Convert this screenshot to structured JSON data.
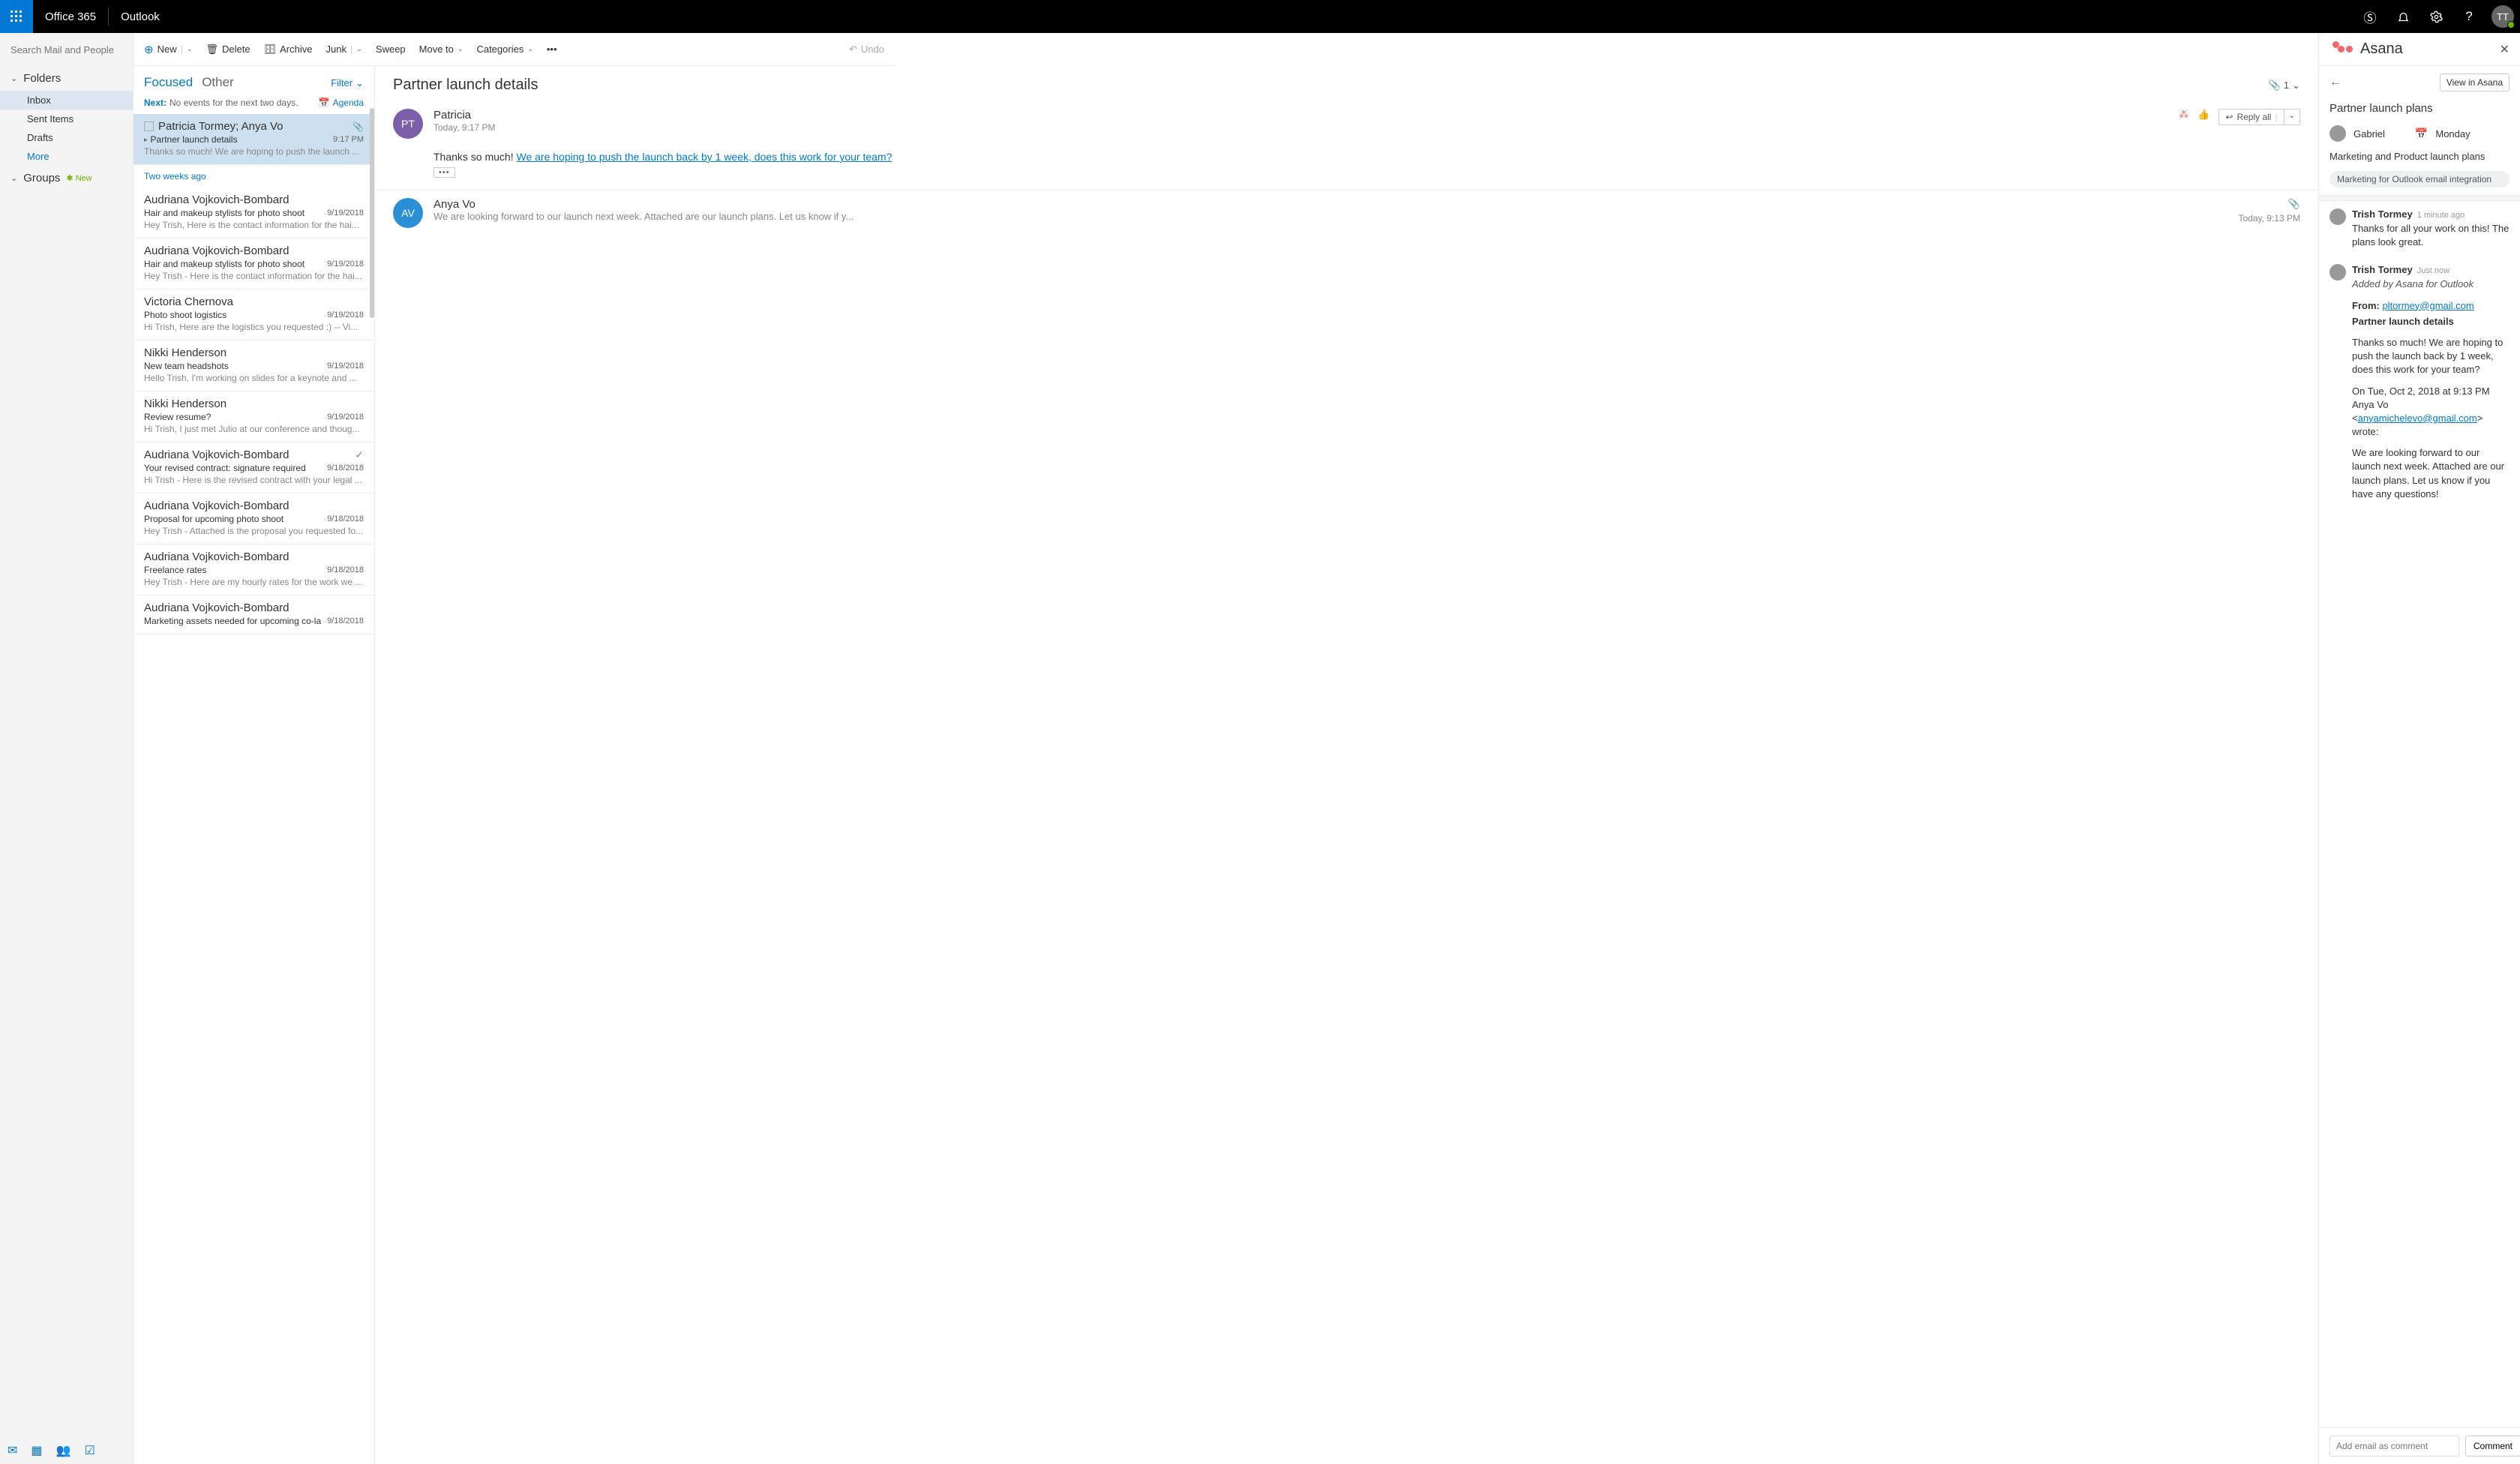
{
  "topbar": {
    "brand": "Office 365",
    "app": "Outlook",
    "avatar_initials": "TT"
  },
  "search": {
    "placeholder": "Search Mail and People"
  },
  "nav": {
    "folders_label": "Folders",
    "inbox": "Inbox",
    "sent": "Sent Items",
    "drafts": "Drafts",
    "more": "More",
    "groups_label": "Groups",
    "new": "New"
  },
  "toolbar": {
    "new": "New",
    "delete": "Delete",
    "archive": "Archive",
    "junk": "Junk",
    "sweep": "Sweep",
    "moveto": "Move to",
    "categories": "Categories",
    "undo": "Undo"
  },
  "list": {
    "focused": "Focused",
    "other": "Other",
    "filter": "Filter",
    "next": "Next:",
    "next_text": "No events for the next two days.",
    "agenda": "Agenda",
    "section_twoweeks": "Two weeks ago",
    "items": [
      {
        "from": "Patricia Tormey; Anya Vo",
        "subj": "Partner launch details",
        "time": "9:17 PM",
        "prev": "Thanks so much! We are hoping to push the launch ...",
        "attach": true,
        "sel": true,
        "thread": true
      },
      {
        "from": "Audriana Vojkovich-Bombard",
        "subj": "Hair and makeup stylists for photo shoot",
        "time": "9/19/2018",
        "prev": "Hey Trish,  Here is the contact information for the hai..."
      },
      {
        "from": "Audriana Vojkovich-Bombard",
        "subj": "Hair and makeup stylists for photo shoot",
        "time": "9/19/2018",
        "prev": "Hey Trish - Here is the contact information for the hai..."
      },
      {
        "from": "Victoria Chernova",
        "subj": "Photo shoot logistics",
        "time": "9/19/2018",
        "prev": "Hi Trish,  Here are the logistics you requested :)  --  Vi..."
      },
      {
        "from": "Nikki Henderson",
        "subj": "New team headshots",
        "time": "9/19/2018",
        "prev": "Hello Trish,  I'm working on slides for a keynote and ..."
      },
      {
        "from": "Nikki Henderson",
        "subj": "Review resume?",
        "time": "9/19/2018",
        "prev": "Hi Trish,  I just met Julio at our conference and thoug..."
      },
      {
        "from": "Audriana Vojkovich-Bombard",
        "subj": "Your revised contract: signature required",
        "time": "9/18/2018",
        "prev": "Hi Trish - Here is the revised contract with your legal ...",
        "done": true
      },
      {
        "from": "Audriana Vojkovich-Bombard",
        "subj": "Proposal for upcoming photo shoot",
        "time": "9/18/2018",
        "prev": "Hey Trish - Attached is the proposal you requested fo..."
      },
      {
        "from": "Audriana Vojkovich-Bombard",
        "subj": "Freelance rates",
        "time": "9/18/2018",
        "prev": "Hey Trish - Here are my hourly rates for the work we ..."
      },
      {
        "from": "Audriana Vojkovich-Bombard",
        "subj": "Marketing assets needed for upcoming co-la",
        "time": "9/18/2018",
        "prev": ""
      }
    ]
  },
  "reading": {
    "subject": "Partner launch details",
    "att_count": "1",
    "msg1": {
      "initials": "PT",
      "name": "Patricia",
      "time": "Today, 9:17 PM",
      "replyall": "Reply all",
      "body_pre": "Thanks so much! ",
      "body_link": "We are hoping to push the launch back by 1 week, does this work for your team?"
    },
    "msg2": {
      "initials": "AV",
      "name": "Anya Vo",
      "preview": "We are looking forward to our launch next week. Attached are our launch plans. Let us know if y...",
      "time": "Today, 9:13 PM"
    }
  },
  "asana": {
    "title": "Asana",
    "view_btn": "View in Asana",
    "task_title": "Partner launch plans",
    "assignee": "Gabriel",
    "due": "Monday",
    "desc": "Marketing and Product launch plans",
    "tag": "Marketing for Outlook email integration",
    "comments": [
      {
        "name": "Trish Tormey",
        "time": "1 minute ago",
        "text": "Thanks for all your work on this! The plans look great."
      },
      {
        "name": "Trish Tormey",
        "time": "Just now",
        "italic": "Added by Asana for Outlook",
        "from_label": "From: ",
        "from_email": "pltormey@gmail.com",
        "subj": "Partner launch details",
        "p1": "Thanks so much! We are hoping to push the launch back by 1 week, does this work for your team?",
        "p2a": "On Tue, Oct 2, 2018 at 9:13 PM Anya Vo <",
        "p2link": "anyamichelevo@gmail.com",
        "p2b": "> wrote:",
        "p3": "We are looking forward to our launch next week. Attached are our launch plans. Let us know if you have any questions!"
      }
    ],
    "input_placeholder": "Add email as comment",
    "comment_btn": "Comment"
  }
}
